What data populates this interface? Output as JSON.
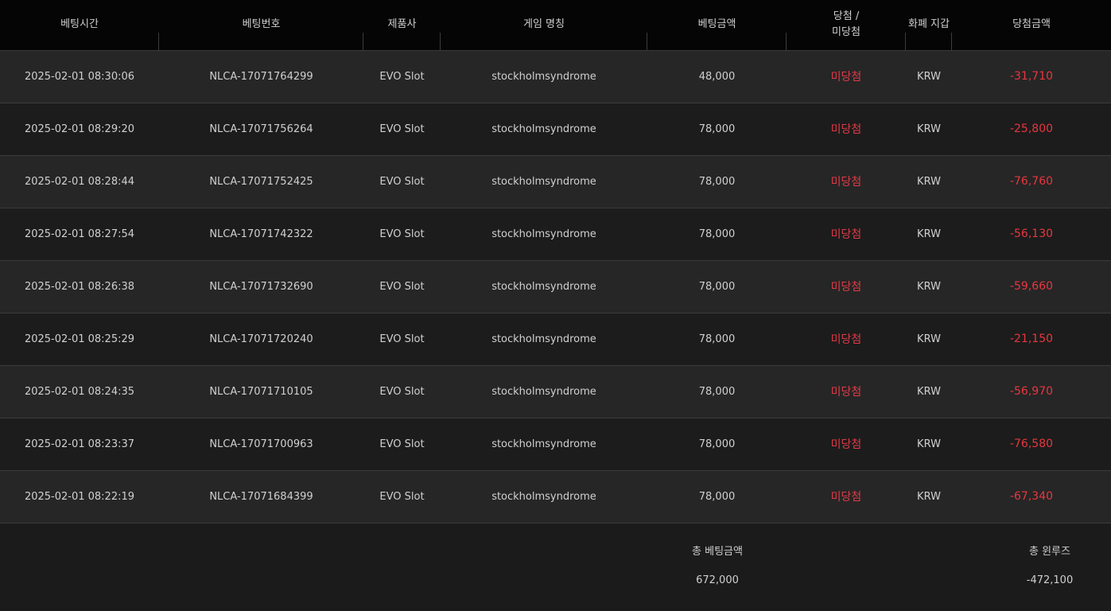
{
  "table": {
    "headers": {
      "bet_time": "베팅시간",
      "bet_number": "베팅번호",
      "provider": "제품사",
      "game_name": "게임 명칭",
      "bet_amount": "베팅금액",
      "result_line1": "당첨 /",
      "result_line2": "미당첨",
      "currency": "화폐 지갑",
      "win_amount": "당첨금액"
    },
    "rows": [
      {
        "time": "2025-02-01 08:30:06",
        "bet_no": "NLCA-17071764299",
        "provider": "EVO Slot",
        "game": "stockholmsyndrome",
        "amount": "48,000",
        "status": "미당첨",
        "currency": "KRW",
        "win": "-31,710"
      },
      {
        "time": "2025-02-01 08:29:20",
        "bet_no": "NLCA-17071756264",
        "provider": "EVO Slot",
        "game": "stockholmsyndrome",
        "amount": "78,000",
        "status": "미당첨",
        "currency": "KRW",
        "win": "-25,800"
      },
      {
        "time": "2025-02-01 08:28:44",
        "bet_no": "NLCA-17071752425",
        "provider": "EVO Slot",
        "game": "stockholmsyndrome",
        "amount": "78,000",
        "status": "미당첨",
        "currency": "KRW",
        "win": "-76,760"
      },
      {
        "time": "2025-02-01 08:27:54",
        "bet_no": "NLCA-17071742322",
        "provider": "EVO Slot",
        "game": "stockholmsyndrome",
        "amount": "78,000",
        "status": "미당첨",
        "currency": "KRW",
        "win": "-56,130"
      },
      {
        "time": "2025-02-01 08:26:38",
        "bet_no": "NLCA-17071732690",
        "provider": "EVO Slot",
        "game": "stockholmsyndrome",
        "amount": "78,000",
        "status": "미당첨",
        "currency": "KRW",
        "win": "-59,660"
      },
      {
        "time": "2025-02-01 08:25:29",
        "bet_no": "NLCA-17071720240",
        "provider": "EVO Slot",
        "game": "stockholmsyndrome",
        "amount": "78,000",
        "status": "미당첨",
        "currency": "KRW",
        "win": "-21,150"
      },
      {
        "time": "2025-02-01 08:24:35",
        "bet_no": "NLCA-17071710105",
        "provider": "EVO Slot",
        "game": "stockholmsyndrome",
        "amount": "78,000",
        "status": "미당첨",
        "currency": "KRW",
        "win": "-56,970"
      },
      {
        "time": "2025-02-01 08:23:37",
        "bet_no": "NLCA-17071700963",
        "provider": "EVO Slot",
        "game": "stockholmsyndrome",
        "amount": "78,000",
        "status": "미당첨",
        "currency": "KRW",
        "win": "-76,580"
      },
      {
        "time": "2025-02-01 08:22:19",
        "bet_no": "NLCA-17071684399",
        "provider": "EVO Slot",
        "game": "stockholmsyndrome",
        "amount": "78,000",
        "status": "미당첨",
        "currency": "KRW",
        "win": "-67,340"
      }
    ]
  },
  "summary": {
    "total_bet_label": "총 베팅금액",
    "total_bet_value": "672,000",
    "total_loss_label": "총 윈루즈",
    "total_loss_value": "-472,100"
  },
  "colors": {
    "background": "#1b1b1b",
    "header_bg": "#050505",
    "row_odd": "#262626",
    "row_even": "#1c1c1c",
    "loss_red": "#e8363f",
    "status_red": "#e03a47"
  }
}
